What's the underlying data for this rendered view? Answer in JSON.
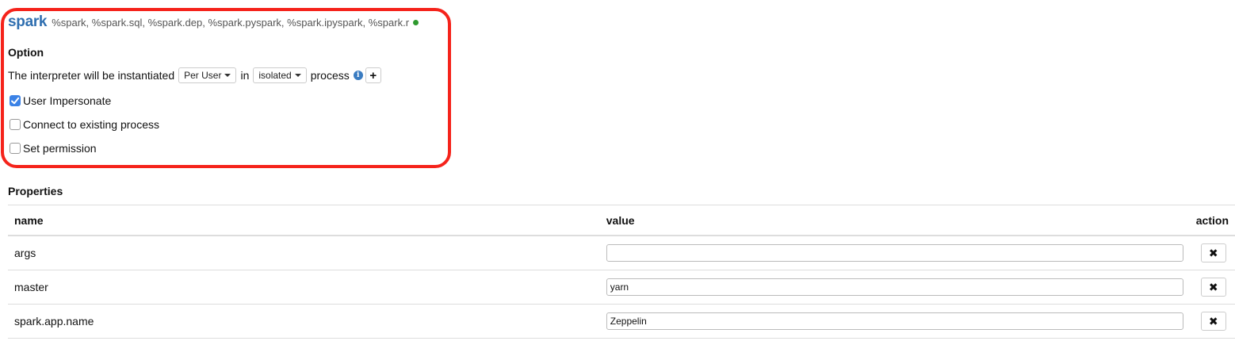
{
  "interpreter": {
    "name": "spark",
    "bindings": "%spark, %spark.sql, %spark.dep, %spark.pyspark, %spark.ipyspark, %spark.r",
    "status_color": "#2e9a2e"
  },
  "option": {
    "title": "Option",
    "instantiate_prefix": "The interpreter will be instantiated",
    "scope_value": "Per User",
    "in_text": "in",
    "mode_value": "isolated",
    "process_text": "process",
    "info_icon": "info-circle",
    "add_icon": "plus"
  },
  "checkboxes": [
    {
      "label": "User Impersonate",
      "checked": true
    },
    {
      "label": "Connect to existing process",
      "checked": false
    },
    {
      "label": "Set permission",
      "checked": false
    }
  ],
  "properties": {
    "title": "Properties",
    "headers": {
      "name": "name",
      "value": "value",
      "action": "action"
    },
    "rows": [
      {
        "name": "args",
        "value": ""
      },
      {
        "name": "master",
        "value": "yarn"
      },
      {
        "name": "spark.app.name",
        "value": "Zeppelin"
      }
    ],
    "remove_icon": "times"
  },
  "colors": {
    "highlight": "#f5231b",
    "accent": "#2f6fb0",
    "checkbox": "#3b82e6"
  }
}
